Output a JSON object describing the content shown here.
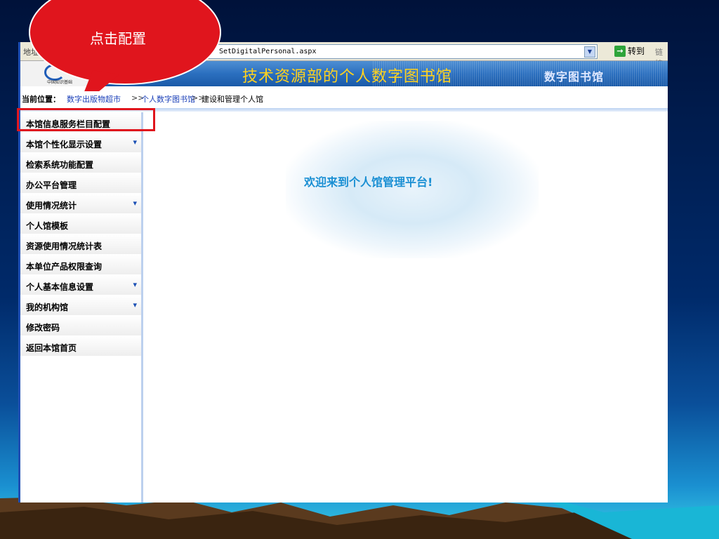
{
  "browser": {
    "address_label": "地址",
    "address_url": "SetDigitalPersonal.aspx",
    "go_label": "转到",
    "links_label": "链接"
  },
  "header": {
    "logo_caption": "中国知识基础",
    "site_title": "技术资源部的个人数字图书馆",
    "brand_title": "数字图书馆"
  },
  "breadcrumb": {
    "prefix": "当前位置：",
    "link1": "数字出版物超市",
    "sep": ">>",
    "link2": "个人数字图书馆",
    "current": "建设和管理个人馆"
  },
  "sidebar": {
    "items": [
      {
        "label": "本馆信息服务栏目配置",
        "expandable": false
      },
      {
        "label": "本馆个性化显示设置",
        "expandable": true
      },
      {
        "label": "检索系统功能配置",
        "expandable": false
      },
      {
        "label": "办公平台管理",
        "expandable": false
      },
      {
        "label": "使用情况统计",
        "expandable": true
      },
      {
        "label": "个人馆模板",
        "expandable": false
      },
      {
        "label": "资源使用情况统计表",
        "expandable": false
      },
      {
        "label": "本单位产品权限查询",
        "expandable": false
      },
      {
        "label": "个人基本信息设置",
        "expandable": true
      },
      {
        "label": "我的机构馆",
        "expandable": true
      },
      {
        "label": "修改密码",
        "expandable": false
      },
      {
        "label": "返回本馆首页",
        "expandable": false
      }
    ],
    "arrow_glyph": "▾"
  },
  "main": {
    "welcome": "欢迎来到个人馆管理平台!"
  },
  "annotation": {
    "callout_text": "点击配置",
    "callout_color": "#e0151d"
  }
}
